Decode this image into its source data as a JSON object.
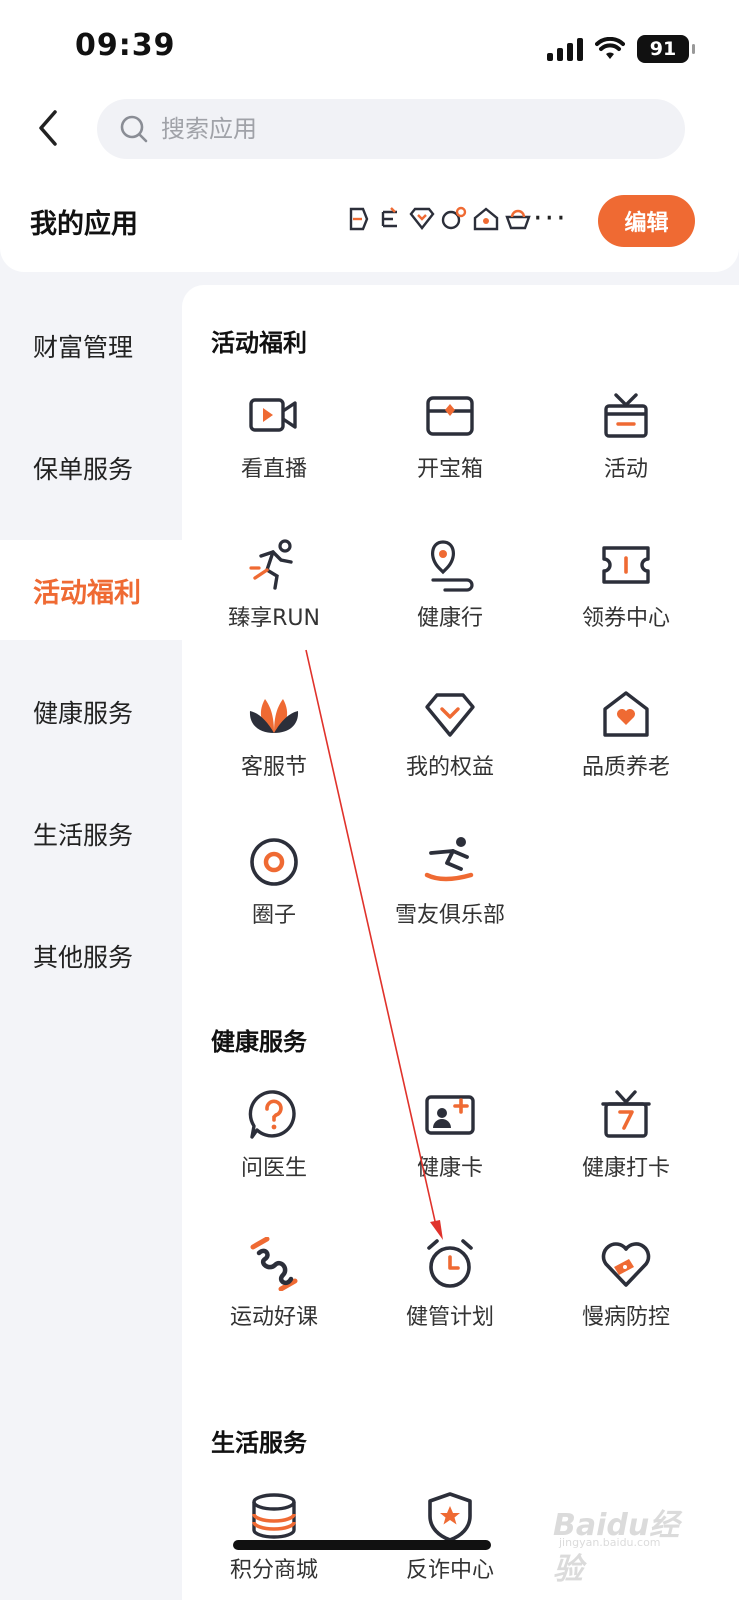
{
  "status": {
    "time": "09:39",
    "battery": "91"
  },
  "search": {
    "placeholder": "搜索应用"
  },
  "my_apps": {
    "title": "我的应用",
    "edit_label": "编辑"
  },
  "sidebar": {
    "items": [
      {
        "label": "财富管理"
      },
      {
        "label": "保单服务"
      },
      {
        "label": "活动福利",
        "active": true
      },
      {
        "label": "健康服务"
      },
      {
        "label": "生活服务"
      },
      {
        "label": "其他服务"
      }
    ]
  },
  "sections": {
    "activity": {
      "title": "活动福利",
      "items": [
        {
          "label": "看直播",
          "icon": "live-video-icon"
        },
        {
          "label": "开宝箱",
          "icon": "treasure-box-icon"
        },
        {
          "label": "活动",
          "icon": "gift-box-icon"
        },
        {
          "label": "臻享RUN",
          "icon": "runner-icon"
        },
        {
          "label": "健康行",
          "icon": "location-path-icon"
        },
        {
          "label": "领券中心",
          "icon": "coupon-icon"
        },
        {
          "label": "客服节",
          "icon": "lotus-icon"
        },
        {
          "label": "我的权益",
          "icon": "diamond-icon"
        },
        {
          "label": "品质养老",
          "icon": "home-heart-icon"
        },
        {
          "label": "圈子",
          "icon": "circle-target-icon"
        },
        {
          "label": "雪友俱乐部",
          "icon": "snowboarder-icon"
        }
      ]
    },
    "health": {
      "title": "健康服务",
      "items": [
        {
          "label": "问医生",
          "icon": "question-bubble-icon"
        },
        {
          "label": "健康卡",
          "icon": "health-card-icon"
        },
        {
          "label": "健康打卡",
          "icon": "calendar-gift-icon"
        },
        {
          "label": "运动好课",
          "icon": "dumbbell-icon"
        },
        {
          "label": "健管计划",
          "icon": "alarm-clock-icon"
        },
        {
          "label": "慢病防控",
          "icon": "heart-bandage-icon"
        }
      ]
    },
    "life": {
      "title": "生活服务",
      "items": [
        {
          "label": "积分商城",
          "icon": "coin-stack-icon"
        },
        {
          "label": "反诈中心",
          "icon": "shield-star-icon"
        }
      ]
    }
  },
  "colors": {
    "accent": "#ef6a33",
    "icon_dark": "#2c2f3a",
    "background": "#f3f4f8"
  },
  "watermark": {
    "brand": "Baidu经验",
    "sub": "jingyan.baidu.com"
  }
}
